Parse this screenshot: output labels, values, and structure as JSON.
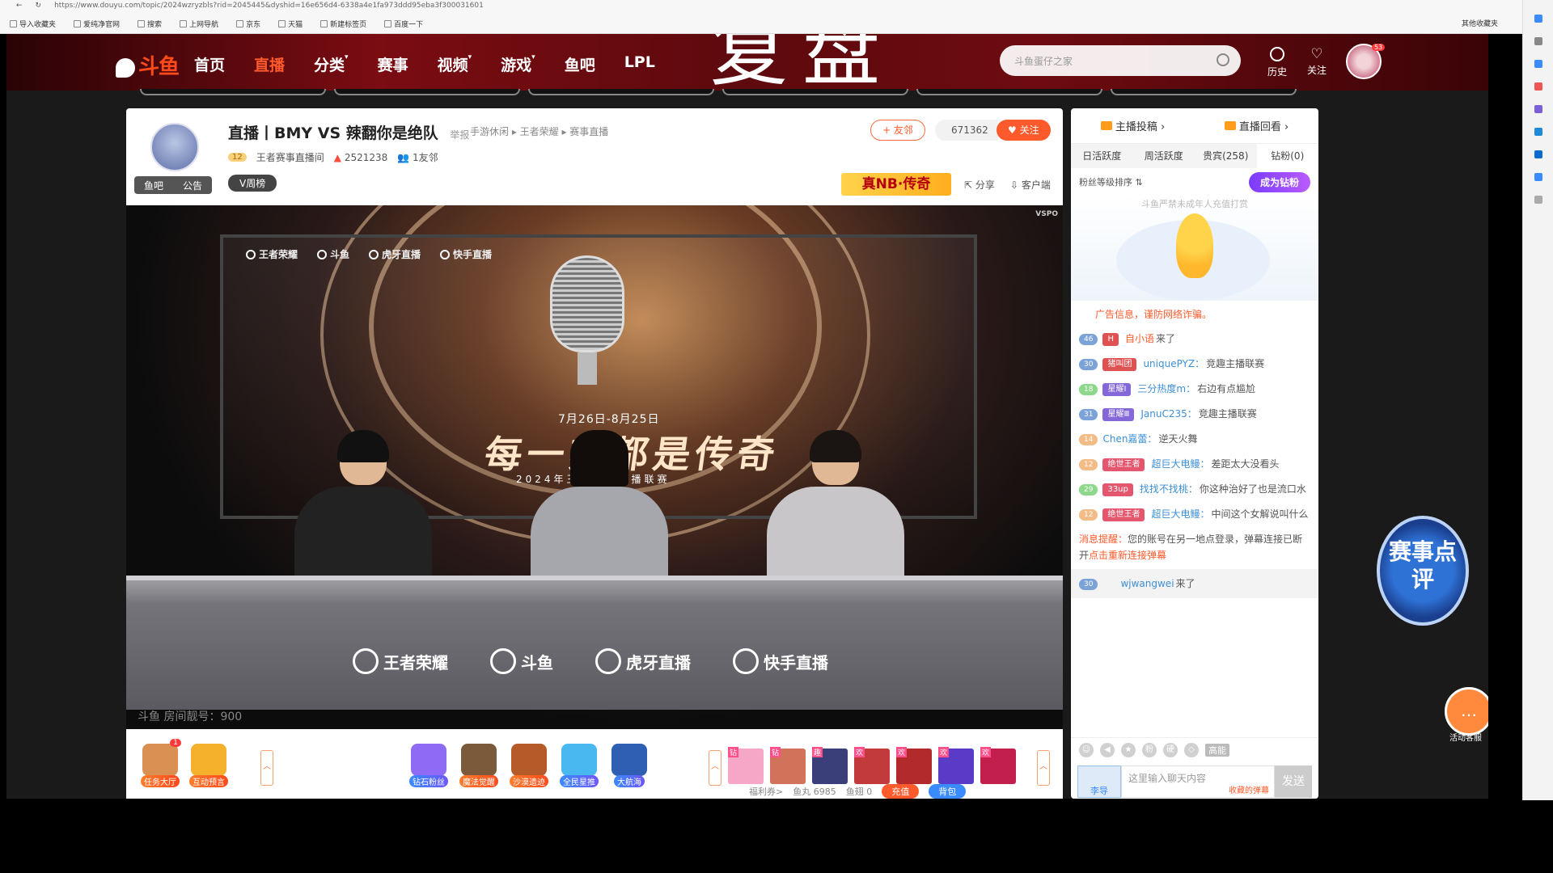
{
  "browser": {
    "url": "https://www.douyu.com/topic/2024wzryzbls?rid=2045445&dyshid=16e656d4-6338a4e1fa973ddd95eba3f300031601",
    "bookmarks": [
      "导入收藏夹",
      "爱纯净官网",
      "搜索",
      "上网导航",
      "京东",
      "天猫",
      "新建标签页",
      "百度一下"
    ],
    "other_bookmarks": "其他收藏夹"
  },
  "nav": {
    "logo": "斗鱼",
    "items": [
      {
        "label": "首页",
        "active": false,
        "caret": ""
      },
      {
        "label": "直播",
        "active": true,
        "caret": ""
      },
      {
        "label": "分类",
        "active": false,
        "caret": "▾"
      },
      {
        "label": "赛事",
        "active": false,
        "caret": ""
      },
      {
        "label": "视频",
        "active": false,
        "caret": "▾"
      },
      {
        "label": "游戏",
        "active": false,
        "caret": "▾"
      },
      {
        "label": "鱼吧",
        "active": false,
        "caret": ""
      },
      {
        "label": "LPL",
        "active": false,
        "caret": ""
      }
    ],
    "search_placeholder": "斗鱼蛋仔之家",
    "history_label": "历史",
    "follow_label": "关注",
    "avatar_badge": "53"
  },
  "overlay_title": "复盘",
  "room": {
    "title": "直播丨BMY VS 辣翻你是绝队",
    "report": "举报",
    "breadcrumbs": "手游休闲 ▸ 王者荣耀 ▸ 赛事直播",
    "level": "12",
    "anchor_name": "王者赛事直播间",
    "heat": "2521238",
    "friends": "1友邻",
    "tags": [
      "鱼吧",
      "公告"
    ],
    "v_week": "V周榜",
    "friend_btn": "+ 友邻",
    "fans_count": "671362",
    "follow_btn": "♥ 关注",
    "ad_badge": "真NB·传奇",
    "share": "分享",
    "client": "客户端"
  },
  "video": {
    "brand_corner": "VSPO",
    "partners_top": [
      "王者荣耀",
      "斗鱼",
      "虎牙直播",
      "快手直播"
    ],
    "date": "7月26日-8月25日",
    "slogan": "每一刻都是传奇",
    "year_line": "2024年王者荣耀主播联赛",
    "sponsors": [
      "王者荣耀",
      "斗鱼",
      "虎牙直播",
      "快手直播"
    ],
    "room_no": "斗鱼 房间靓号：900"
  },
  "gifts": {
    "left": [
      {
        "label": "任务大厅",
        "badge": "1",
        "color": "#d99052"
      },
      {
        "label": "互动预言",
        "badge": "",
        "color": "#f5b12b"
      }
    ],
    "right": [
      {
        "label": "钻石粉丝",
        "style": "blue",
        "color": "#8f6bf5"
      },
      {
        "label": "魔法觉醒",
        "style": "",
        "color": "#7a5a3a"
      },
      {
        "label": "沙漠遗迹",
        "style": "",
        "color": "#b55b2a"
      },
      {
        "label": "全民星推",
        "style": "blue",
        "color": "#4ab8f0"
      },
      {
        "label": "大航海",
        "style": "blue",
        "color": "#2f5fb3"
      }
    ],
    "tiles": [
      {
        "tag": "钻",
        "color": "#f6a6c6"
      },
      {
        "tag": "钻",
        "color": "#d1735a"
      },
      {
        "tag": "趣",
        "color": "#3a3f7a"
      },
      {
        "tag": "欢",
        "color": "#c23a3a"
      },
      {
        "tag": "欢",
        "color": "#b22a2a"
      },
      {
        "tag": "欢",
        "color": "#5a3bc8"
      },
      {
        "tag": "欢",
        "color": "#c21f4c"
      }
    ],
    "welfare": "福利券>",
    "fish_ball": "鱼丸 6985",
    "fish_wing": "鱼翅 0",
    "recharge": "充值",
    "bag": "背包"
  },
  "sidebar": {
    "top_tabs": [
      "主播投稿 ›",
      "直播回看 ›"
    ],
    "rank_tabs": [
      "日活跃度",
      "周活跃度",
      "贵宾(258)",
      "钻粉(0)"
    ],
    "fan_sort": "粉丝等级排序 ⇅",
    "be_fan": "成为钻粉",
    "rank_notice": "斗鱼严禁未成年人充值打赏",
    "ad_line": "广告信息，谨防网络诈骗。",
    "messages": [
      {
        "lv": "46",
        "lvcolor": "blue",
        "medal": "H",
        "medalcolor": "m-red",
        "user": "自小语",
        "userclass": "o",
        "text": "来了"
      },
      {
        "lv": "30",
        "lvcolor": "blue",
        "medal": "猪叫团",
        "medalcolor": "m-red",
        "user": "uniquePYZ：",
        "userclass": "",
        "text": "竞趣主播联赛"
      },
      {
        "lv": "18",
        "lvcolor": "green",
        "medal": "星耀Ⅰ",
        "medalcolor": "m-purple",
        "user": "三分热度m：",
        "userclass": "",
        "text": "右边有点尴尬"
      },
      {
        "lv": "31",
        "lvcolor": "blue",
        "medal": "星耀Ⅲ",
        "medalcolor": "m-purple",
        "user": "JanuC235：",
        "userclass": "",
        "text": "竞趣主播联赛"
      },
      {
        "lv": "14",
        "lvcolor": "orange",
        "medal": "",
        "medalcolor": "",
        "user": "Chen嘉蕾：",
        "userclass": "",
        "text": "逆天火舞"
      },
      {
        "lv": "12",
        "lvcolor": "orange",
        "medal": "绝世王者",
        "medalcolor": "m-pink",
        "user": "超巨大电鳗：",
        "userclass": "",
        "text": "差距太大没看头"
      },
      {
        "lv": "29",
        "lvcolor": "green",
        "medal": "33up",
        "medalcolor": "m-pink",
        "user": "找找不找桃：",
        "userclass": "",
        "text": "你这种治好了也是流口水"
      },
      {
        "lv": "12",
        "lvcolor": "orange",
        "medal": "绝世王者",
        "medalcolor": "m-pink",
        "user": "超巨大电鳗：",
        "userclass": "",
        "text": "中间这个女解说叫什么"
      }
    ],
    "sys_msg": {
      "label": "消息提醒：",
      "text": "您的账号在另一地点登录，弹幕连接已断开",
      "link": "点击重新连接弹幕"
    },
    "welcome": {
      "lv": "30",
      "user": "wjwangwei",
      "text": "来了"
    },
    "tools": [
      "☺",
      "◀",
      "★",
      "粉",
      "硬",
      "◇"
    ],
    "high_energy": "高能",
    "nick": "李导",
    "input_placeholder": "这里输入聊天内容",
    "invite": "收藏的弹幕",
    "send": "发送"
  },
  "floating": {
    "match_review": "赛事点评",
    "customer_service": "活动客服"
  }
}
